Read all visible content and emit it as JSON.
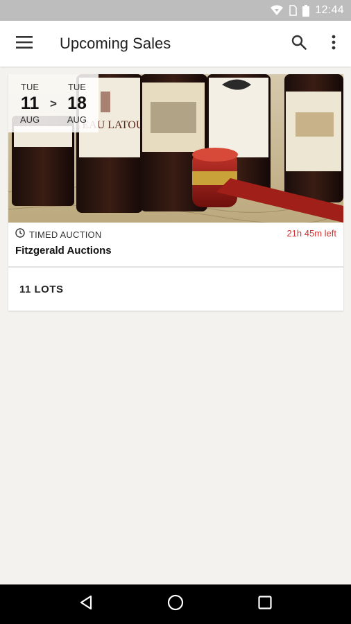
{
  "status_bar": {
    "time": "12:44",
    "icons": [
      "wifi-icon",
      "sim-icon",
      "battery-icon"
    ]
  },
  "app_bar": {
    "title": "Upcoming Sales",
    "icons": [
      "menu-icon",
      "search-icon",
      "more-vert-icon"
    ]
  },
  "sale_card": {
    "start": {
      "day": "TUE",
      "date": "11",
      "month": "AUG"
    },
    "separator": ">",
    "end": {
      "day": "TUE",
      "date": "18",
      "month": "AUG"
    },
    "auction_type": "TIMED AUCTION",
    "time_left": "21h 45m left",
    "auctioneer": "Fitzgerald Auctions",
    "lots": "11 LOTS",
    "image_description": "wine-bottles-and-gavel"
  },
  "colors": {
    "accent_red": "#d32f2f",
    "status_bar": "#bdbdbd",
    "background": "#f3f2ee"
  },
  "nav_bar": {
    "icons": [
      "back-icon",
      "home-icon",
      "recents-icon"
    ]
  }
}
